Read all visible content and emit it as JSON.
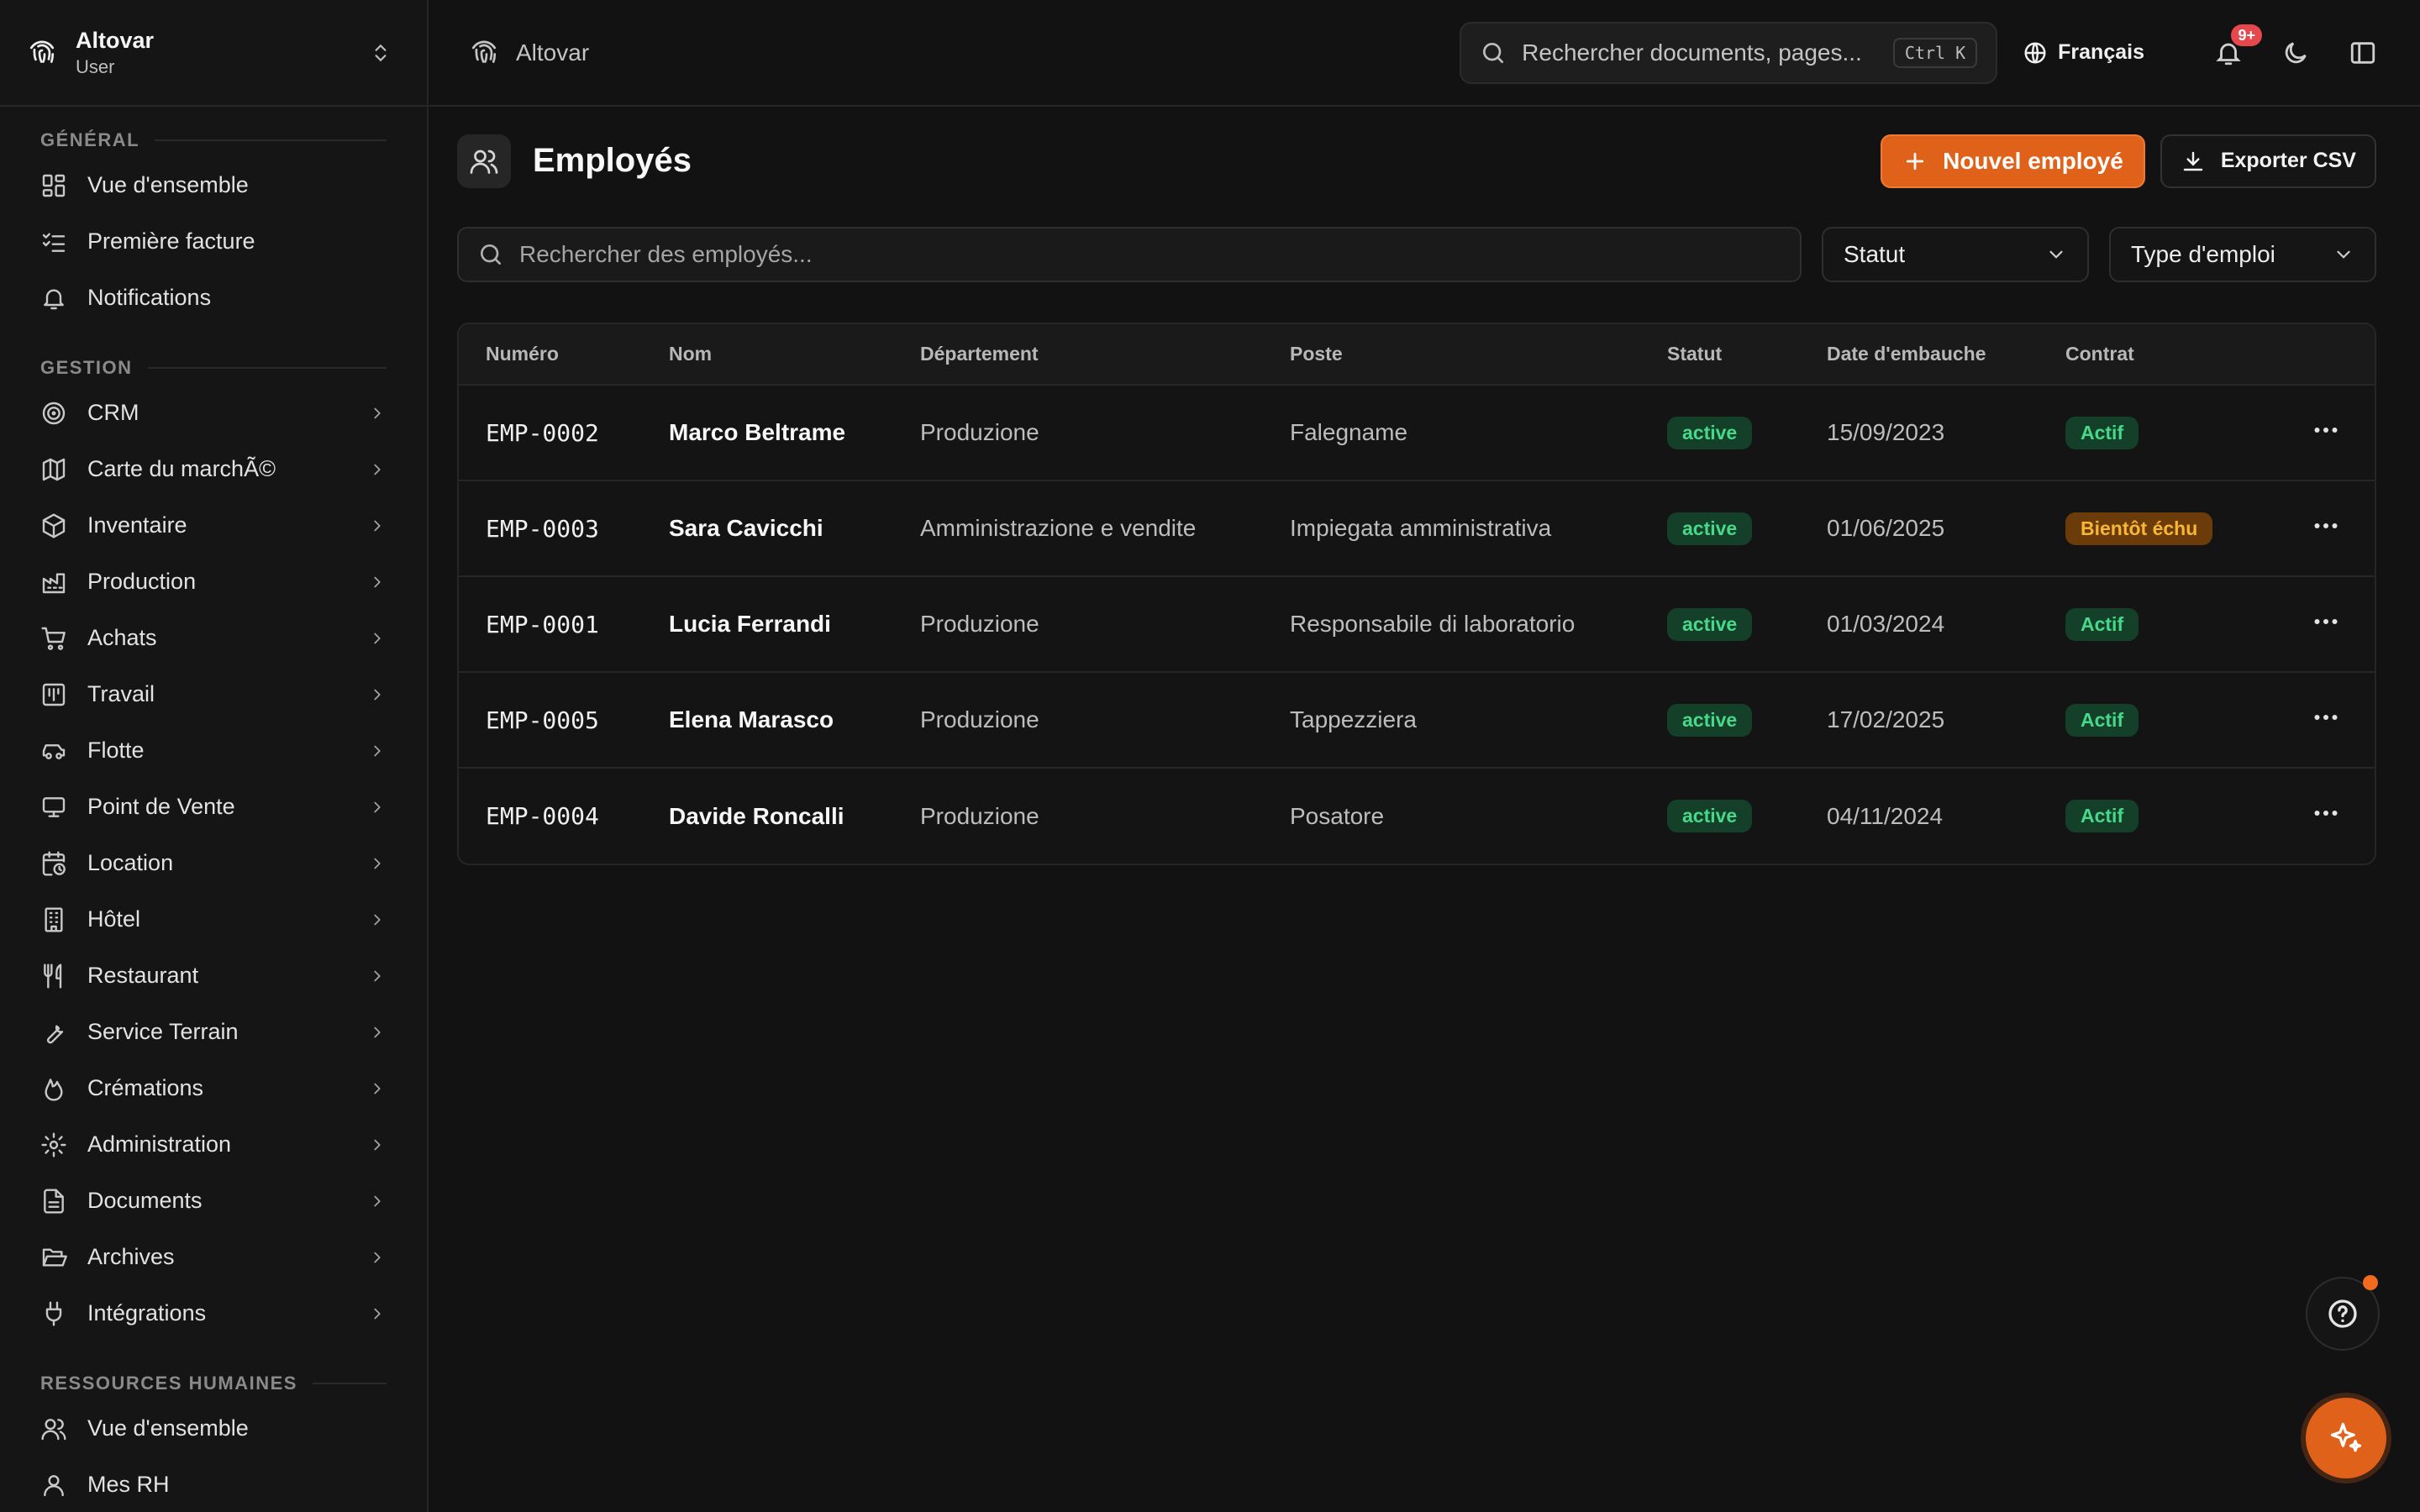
{
  "org": {
    "name": "Altovar",
    "role": "User"
  },
  "topbar": {
    "brand": "Altovar",
    "search_placeholder": "Rechercher documents, pages...",
    "shortcut": "Ctrl K",
    "language": "Français",
    "notif_badge": "9+"
  },
  "sidebar": {
    "sections": [
      {
        "label": "GÉNÉRAL",
        "items": [
          {
            "label": "Vue d'ensemble",
            "icon": "grid-icon",
            "chevron": false
          },
          {
            "label": "Première facture",
            "icon": "checklist-icon",
            "chevron": false
          },
          {
            "label": "Notifications",
            "icon": "bell-icon",
            "chevron": false
          }
        ]
      },
      {
        "label": "GESTION",
        "items": [
          {
            "label": "CRM",
            "icon": "target-icon",
            "chevron": true
          },
          {
            "label": "Carte du marchÃ©",
            "icon": "map-icon",
            "chevron": true
          },
          {
            "label": "Inventaire",
            "icon": "box-icon",
            "chevron": true
          },
          {
            "label": "Production",
            "icon": "factory-icon",
            "chevron": true
          },
          {
            "label": "Achats",
            "icon": "cart-icon",
            "chevron": true
          },
          {
            "label": "Travail",
            "icon": "kanban-icon",
            "chevron": true
          },
          {
            "label": "Flotte",
            "icon": "car-icon",
            "chevron": true
          },
          {
            "label": "Point de Vente",
            "icon": "monitor-icon",
            "chevron": true
          },
          {
            "label": "Location",
            "icon": "calendar-clock-icon",
            "chevron": true
          },
          {
            "label": "Hôtel",
            "icon": "building-icon",
            "chevron": true
          },
          {
            "label": "Restaurant",
            "icon": "utensils-icon",
            "chevron": true
          },
          {
            "label": "Service Terrain",
            "icon": "wrench-icon",
            "chevron": true
          },
          {
            "label": "Crémations",
            "icon": "flame-icon",
            "chevron": true
          },
          {
            "label": "Administration",
            "icon": "gear-icon",
            "chevron": true
          },
          {
            "label": "Documents",
            "icon": "file-icon",
            "chevron": true
          },
          {
            "label": "Archives",
            "icon": "folder-open-icon",
            "chevron": true
          },
          {
            "label": "Intégrations",
            "icon": "plug-icon",
            "chevron": true
          }
        ]
      },
      {
        "label": "RESSOURCES HUMAINES",
        "items": [
          {
            "label": "Vue d'ensemble",
            "icon": "users-icon",
            "chevron": false
          },
          {
            "label": "Mes RH",
            "icon": "user-icon",
            "chevron": false
          }
        ]
      }
    ]
  },
  "page": {
    "title": "Employés",
    "new_button": "Nouvel employé",
    "export_button": "Exporter CSV",
    "search_placeholder": "Rechercher des employés...",
    "filter_status": "Statut",
    "filter_type": "Type d'emploi"
  },
  "table": {
    "columns": [
      "Numéro",
      "Nom",
      "Département",
      "Poste",
      "Statut",
      "Date d'embauche",
      "Contrat"
    ],
    "rows": [
      {
        "num": "EMP-0002",
        "name": "Marco Beltrame",
        "dept": "Produzione",
        "role": "Falegname",
        "status": "active",
        "hired": "15/09/2023",
        "contract": "Actif",
        "contract_tone": "green"
      },
      {
        "num": "EMP-0003",
        "name": "Sara Cavicchi",
        "dept": "Amministrazione e vendite",
        "role": "Impiegata amministrativa",
        "status": "active",
        "hired": "01/06/2025",
        "contract": "Bientôt échu",
        "contract_tone": "amber"
      },
      {
        "num": "EMP-0001",
        "name": "Lucia Ferrandi",
        "dept": "Produzione",
        "role": "Responsabile di laboratorio",
        "status": "active",
        "hired": "01/03/2024",
        "contract": "Actif",
        "contract_tone": "green"
      },
      {
        "num": "EMP-0005",
        "name": "Elena Marasco",
        "dept": "Produzione",
        "role": "Tappezziera",
        "status": "active",
        "hired": "17/02/2025",
        "contract": "Actif",
        "contract_tone": "green"
      },
      {
        "num": "EMP-0004",
        "name": "Davide Roncalli",
        "dept": "Produzione",
        "role": "Posatore",
        "status": "active",
        "hired": "04/11/2024",
        "contract": "Actif",
        "contract_tone": "green"
      }
    ]
  },
  "colors": {
    "accent": "#e0611a",
    "success": "#47d889",
    "warning": "#f7b733",
    "danger": "#e5484d"
  }
}
